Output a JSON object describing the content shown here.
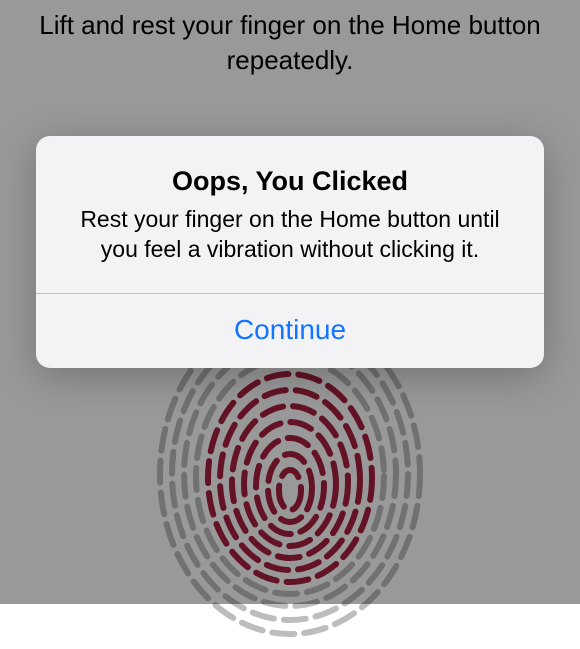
{
  "background": {
    "instruction": "Lift and rest your finger on the Home button repeatedly."
  },
  "alert": {
    "title": "Oops, You Clicked",
    "message": "Rest your finger on the Home button until you feel a vibration without clicking it.",
    "button_label": "Continue"
  },
  "colors": {
    "accent_blue": "#1274ff",
    "fingerprint_red": "#a5213e",
    "fingerprint_gray": "#bdbdbd"
  }
}
